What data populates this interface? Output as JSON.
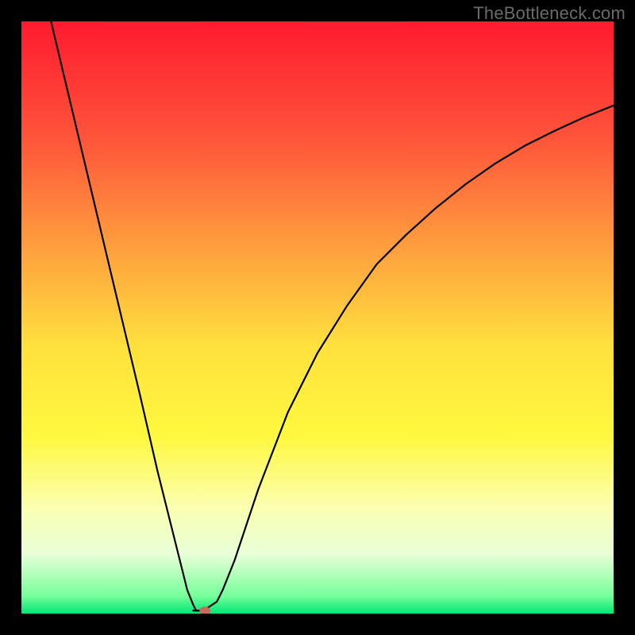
{
  "watermark": "TheBottleneck.com",
  "chart_data": {
    "type": "line",
    "title": "",
    "xlabel": "",
    "ylabel": "",
    "xlim": [
      0,
      100
    ],
    "ylim": [
      0,
      100
    ],
    "grid": false,
    "legend": false,
    "gradient_stops": [
      {
        "pct": 0,
        "color": "#ff1a2f"
      },
      {
        "pct": 20,
        "color": "#ff553a"
      },
      {
        "pct": 40,
        "color": "#ffa63e"
      },
      {
        "pct": 55,
        "color": "#ffe13d"
      },
      {
        "pct": 70,
        "color": "#fff83e"
      },
      {
        "pct": 82,
        "color": "#fbffb0"
      },
      {
        "pct": 90,
        "color": "#e8ffd8"
      },
      {
        "pct": 97,
        "color": "#77ff9a"
      },
      {
        "pct": 100,
        "color": "#00e676"
      }
    ],
    "series": [
      {
        "name": "bottleneck-curve",
        "stroke": "#000000",
        "stroke_width": 2.2,
        "x": [
          5,
          10,
          15,
          20,
          23,
          26,
          28,
          29,
          29.5,
          30,
          31,
          33,
          34,
          36,
          40,
          45,
          50,
          55,
          60,
          65,
          70,
          75,
          80,
          85,
          90,
          95,
          100
        ],
        "y": [
          100,
          79,
          58,
          37,
          24,
          12,
          4,
          1.5,
          0.5,
          0.5,
          0.7,
          2,
          4,
          9,
          21,
          34,
          44,
          52,
          59,
          64,
          68.5,
          72.5,
          76,
          79,
          81.5,
          83.8,
          85.8
        ]
      },
      {
        "name": "bottleneck-floor-gap",
        "stroke": "#000000",
        "stroke_width": 2.2,
        "x": [
          29,
          31
        ],
        "y": [
          0.5,
          0.5
        ]
      }
    ],
    "marker": {
      "name": "optimal-point",
      "x": 31,
      "y": 0.5,
      "rx": 7,
      "ry": 5,
      "fill": "#c76b5a"
    }
  }
}
